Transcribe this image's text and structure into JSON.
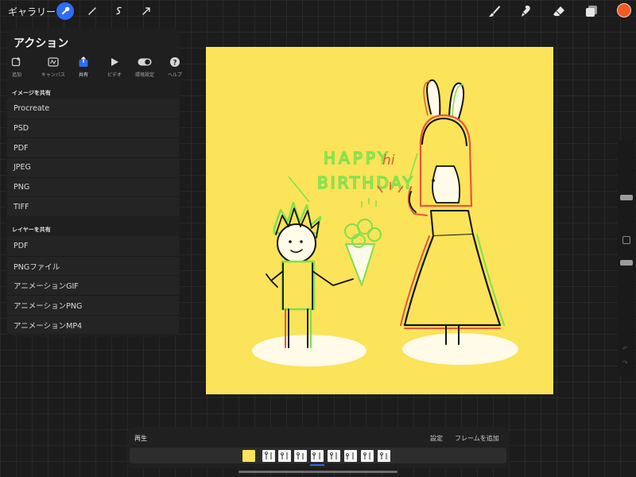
{
  "topbar": {
    "gallery_label": "ギャラリー",
    "left_tools": [
      "wrench-icon",
      "magic-wand-icon",
      "selection-icon",
      "transform-arrow-icon"
    ],
    "right_tools": [
      "brush-icon",
      "smudge-icon",
      "eraser-icon",
      "layers-icon"
    ],
    "current_color": "#f4591f"
  },
  "actions": {
    "title": "アクション",
    "tabs": [
      {
        "label": "追加",
        "icon": "add-image-icon"
      },
      {
        "label": "キャンバス",
        "icon": "canvas-icon"
      },
      {
        "label": "共有",
        "icon": "share-icon"
      },
      {
        "label": "ビデオ",
        "icon": "play-icon"
      },
      {
        "label": "環境設定",
        "icon": "toggle-icon"
      },
      {
        "label": "ヘルプ",
        "icon": "help-icon"
      }
    ],
    "active_tab": "共有",
    "image_section": {
      "heading": "イメージを共有",
      "items": [
        "Procreate",
        "PSD",
        "PDF",
        "JPEG",
        "PNG",
        "TIFF"
      ]
    },
    "layer_section": {
      "heading": "レイヤーを共有",
      "items": [
        "PDF",
        "PNGファイル",
        "アニメーションGIF",
        "アニメーションPNG",
        "アニメーションMP4"
      ]
    }
  },
  "canvas": {
    "background": "#fbe35a",
    "text_happy": "HAPPY",
    "text_birthday": "BIRTHDAY",
    "text_hi": "hi"
  },
  "timeline": {
    "play_label": "再生",
    "settings_label": "設定",
    "add_frame_label": "フレームを追加"
  },
  "colors": {
    "accent": "#2f6df6",
    "panel_bg": "#1f1f1f"
  }
}
